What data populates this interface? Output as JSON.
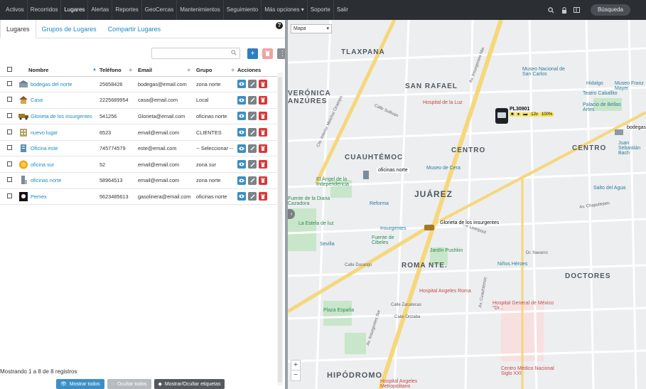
{
  "nav": {
    "items": [
      "Activos",
      "Recorridos",
      "Lugares",
      "Alertas",
      "Reportes",
      "GeoCercas",
      "Mantenimientos",
      "Seguimiento",
      "Más opciones ▾",
      "Soporte",
      "Salir"
    ],
    "active_index": 2,
    "search_label": "Búsqueda"
  },
  "tabs": [
    "Lugares",
    "Grupos de Lugares",
    "Compartir Lugares"
  ],
  "table": {
    "headers": [
      "Nombre",
      "Teléfono",
      "Email",
      "Grupo",
      "Acciones"
    ],
    "rows": [
      {
        "name": "bodegas del norte",
        "tel": "25658426",
        "email": "bodegas@email.com",
        "group": "zona norte",
        "icon": "warehouse-icon"
      },
      {
        "name": "Casa",
        "tel": "2225689954",
        "email": "casa@email.com",
        "group": "Local",
        "icon": "house-icon"
      },
      {
        "name": "Glorieta de los insurgentes",
        "tel": "541256",
        "email": "Glorieta@email.com",
        "group": "oficinas norte",
        "icon": "truck-icon"
      },
      {
        "name": "nuevo lugar",
        "tel": "6523",
        "email": "email@email.com",
        "group": "CLIENTES",
        "icon": "building-icon"
      },
      {
        "name": "Oficina este",
        "tel": "745774579",
        "email": "este@email.com",
        "group": "-- Seleccionar --",
        "icon": "office-icon"
      },
      {
        "name": "oficina sur",
        "tel": "52",
        "email": "email@email.com",
        "group": "zona sur",
        "icon": "sun-icon"
      },
      {
        "name": "oficinas norte",
        "tel": "58964513",
        "email": "email@email.com",
        "group": "zona norte",
        "icon": "tower-icon"
      },
      {
        "name": "Pemex",
        "tel": "5623485613",
        "email": "gasolinera@email.com",
        "group": "oficinas norte",
        "icon": "fuel-icon"
      }
    ]
  },
  "footer": {
    "summary": "Mostrando 1 a 8 de 8 registros",
    "show_all": "Mostrar todos",
    "hide_all": "Ocultar todos",
    "toggle_labels": "Mostrar/Ocultar etiquetas"
  },
  "map": {
    "type_select": "Mapa",
    "zoom_in": "+",
    "zoom_out": "−",
    "districts": [
      "TLAXPANA",
      "SAN RAFAEL",
      "VERÓNICA ANZÚRES",
      "CUAUHTÉMOC",
      "JUÁREZ",
      "CENTRO",
      "CENTRO",
      "ROMA NTE.",
      "DOCTORES",
      "HIPÓDROMO"
    ],
    "pois": [
      "Hospital de la Luz",
      "Museo Nacional de San Carlos",
      "Teatro Caballito",
      "Palacio de Bellas Artes",
      "Museo de Cera",
      "El Ángel de la Independencia",
      "Fuente de la Diana Cazadora",
      "La Estela de luz",
      "Fuente de Cibeles",
      "Jardín Pushkin",
      "Hospital Angeles Roma",
      "Hospital General de México \"Dr...",
      "Centro Médico Nacional Siglo XXI",
      "Hospital Angeles Metropolitano",
      "Niños Héroes",
      "Salto del Agua",
      "Plaza España",
      "Museo Franz Mayer",
      "Hidalgo",
      "Juan Sebastián Bach",
      "Insurgentes",
      "Sevilla",
      "Reforma"
    ],
    "streets": [
      "Av. Insurgentes Nte.",
      "Av. Insurgentes Sur",
      "Cto. Interior Melchor Ocampo",
      "Calle Sullivan",
      "Calle Liverpool",
      "Calle Durango",
      "Calle Orizaba",
      "Av. Cuauhtémoc",
      "Dr. Navarro",
      "Calle Zacatecas",
      "Av. Chapultepec"
    ],
    "markers": [
      "oficinas norte",
      "Glorieta de los insurgentes",
      "bodegas"
    ],
    "vehicle": {
      "plate": "PL30901",
      "chips": [
        "12v",
        "100%"
      ]
    }
  }
}
